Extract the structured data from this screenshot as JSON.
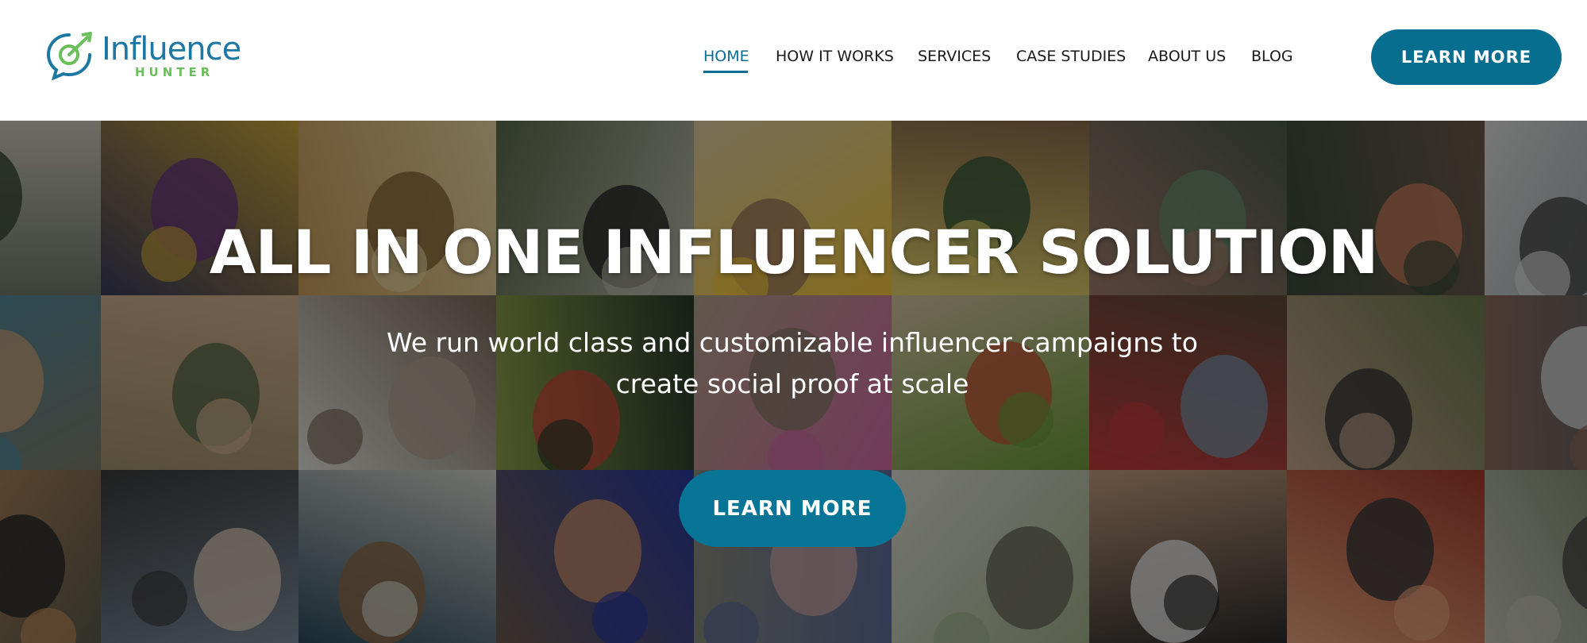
{
  "brand": {
    "name": "Influence",
    "tagline": "HUNTER",
    "primary_color": "#086e8f",
    "accent_color": "#6abf5a",
    "logo_icon": "chat-bubble-target-icon"
  },
  "nav": {
    "items": [
      {
        "label": "HOME",
        "active": true
      },
      {
        "label": "HOW IT WORKS",
        "active": false
      },
      {
        "label": "SERVICES",
        "active": false
      },
      {
        "label": "CASE STUDIES",
        "active": false
      },
      {
        "label": "ABOUT US",
        "active": false
      },
      {
        "label": "BLOG",
        "active": false
      }
    ],
    "cta_label": "LEARN MORE"
  },
  "hero": {
    "title": "ALL IN ONE INFLUENCER SOLUTION",
    "subtitle_line1": "We run world class and customizable influencer campaigns to",
    "subtitle_line2": "create social proof at scale",
    "cta_label": "LEARN MORE",
    "background": "photo-collage"
  }
}
